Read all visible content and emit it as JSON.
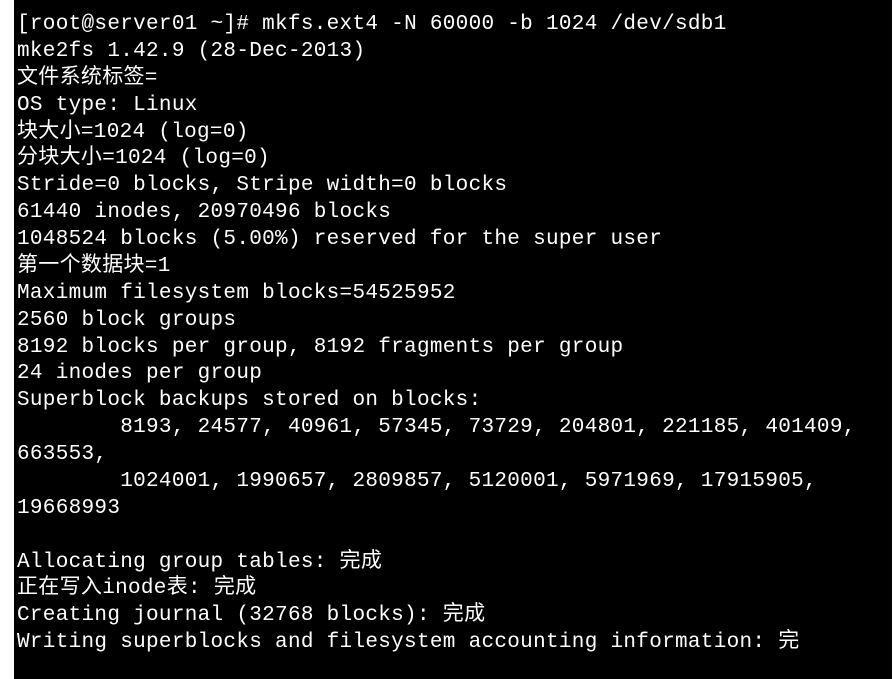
{
  "prompt": "[root@server01 ~]# ",
  "command": "mkfs.ext4 -N 60000 -b 1024 /dev/sdb1",
  "output_lines": [
    "mke2fs 1.42.9 (28-Dec-2013)",
    "文件系统标签=",
    "OS type: Linux",
    "块大小=1024 (log=0)",
    "分块大小=1024 (log=0)",
    "Stride=0 blocks, Stripe width=0 blocks",
    "61440 inodes, 20970496 blocks",
    "1048524 blocks (5.00%) reserved for the super user",
    "第一个数据块=1",
    "Maximum filesystem blocks=54525952",
    "2560 block groups",
    "8192 blocks per group, 8192 fragments per group",
    "24 inodes per group",
    "Superblock backups stored on blocks: ",
    "        8193, 24577, 40961, 57345, 73729, 204801, 221185, 401409, 663553, ",
    "        1024001, 1990657, 2809857, 5120001, 5971969, 17915905, 19668993",
    "",
    "Allocating group tables: 完成",
    "正在写入inode表: 完成",
    "Creating journal (32768 blocks): 完成",
    "Writing superblocks and filesystem accounting information: 完"
  ]
}
